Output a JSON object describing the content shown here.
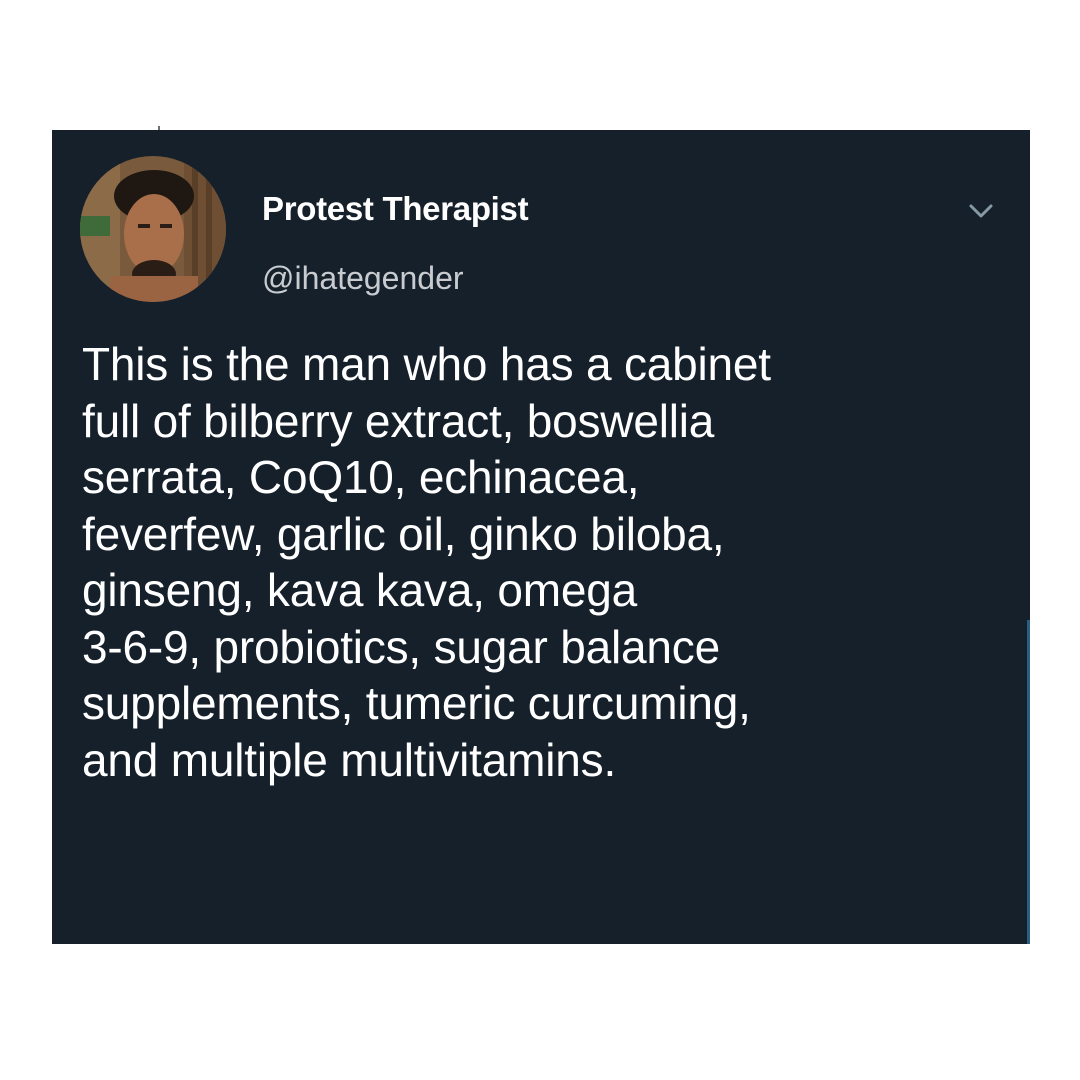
{
  "tweet": {
    "author": {
      "display_name": "Protest Therapist",
      "handle": "@ihategender"
    },
    "text_lines": [
      "This is the man who has a cabinet",
      "full of bilberry extract, boswellia",
      "serrata, CoQ10, echinacea,",
      "feverfew, garlic oil, ginko biloba,",
      "ginseng, kava kava, omega",
      "3-6-9, probiotics, sugar balance",
      "supplements, tumeric curcuming,",
      "and multiple multivitamins."
    ],
    "menu_icon": "chevron-down-icon"
  },
  "colors": {
    "page_background": "#ffffff",
    "card_background": "#15202b",
    "text_primary": "#ffffff",
    "text_secondary": "#c8ccd1",
    "icon": "#8899a6"
  }
}
